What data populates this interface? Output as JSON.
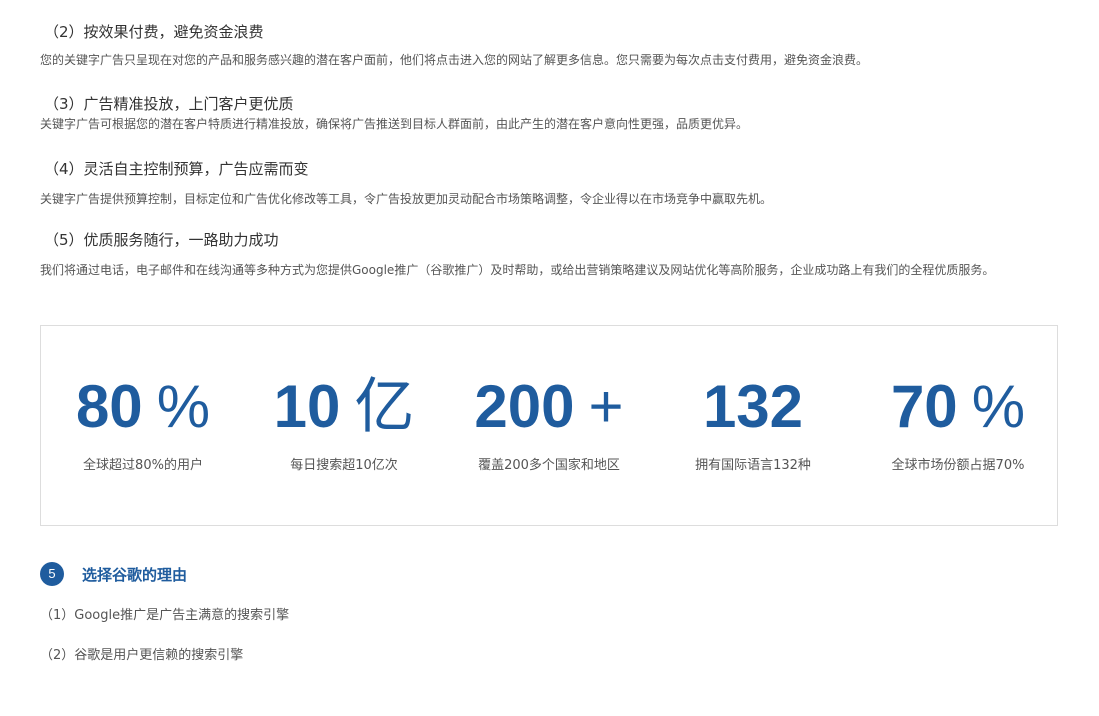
{
  "features": [
    {
      "title": "（2）按效果付费，避免资金浪费",
      "desc": "您的关键字广告只呈现在对您的产品和服务感兴趣的潜在客户面前，他们将点击进入您的网站了解更多信息。您只需要为每次点击支付费用，避免资金浪费。"
    },
    {
      "title": "（3）广告精准投放，上门客户更优质",
      "desc": "关键字广告可根据您的潜在客户特质进行精准投放，确保将广告推送到目标人群面前，由此产生的潜在客户意向性更强，品质更优异。"
    },
    {
      "title": "（4）灵活自主控制预算，广告应需而变",
      "desc": "关键字广告提供预算控制，目标定位和广告优化修改等工具，令广告投放更加灵动配合市场策略调整，令企业得以在市场竞争中赢取先机。"
    },
    {
      "title": "（5）优质服务随行，一路助力成功",
      "desc": "我们将通过电话，电子邮件和在线沟通等多种方式为您提供Google推广（谷歌推广）及时帮助，或给出营销策略建议及网站优化等高阶服务，企业成功路上有我们的全程优质服务。"
    }
  ],
  "stats": [
    {
      "number": "80",
      "unit": "%",
      "label": "全球超过80%的用户"
    },
    {
      "number": "10",
      "unit": "亿",
      "label": "每日搜索超10亿次"
    },
    {
      "number": "200",
      "unit": "+",
      "label": "覆盖200多个国家和地区"
    },
    {
      "number": "132",
      "unit": "",
      "label": "拥有国际语言132种"
    },
    {
      "number": "70",
      "unit": "%",
      "label": "全球市场份额占据70%"
    }
  ],
  "section": {
    "number": "5",
    "title": "选择谷歌的理由"
  },
  "reasons": [
    "（1）Google推广是广告主满意的搜索引擎",
    "（2）谷歌是用户更信赖的搜索引擎"
  ],
  "colors": {
    "accent": "#1f5c9e",
    "border": "#dddddd",
    "text": "#333333",
    "muted": "#555555"
  }
}
